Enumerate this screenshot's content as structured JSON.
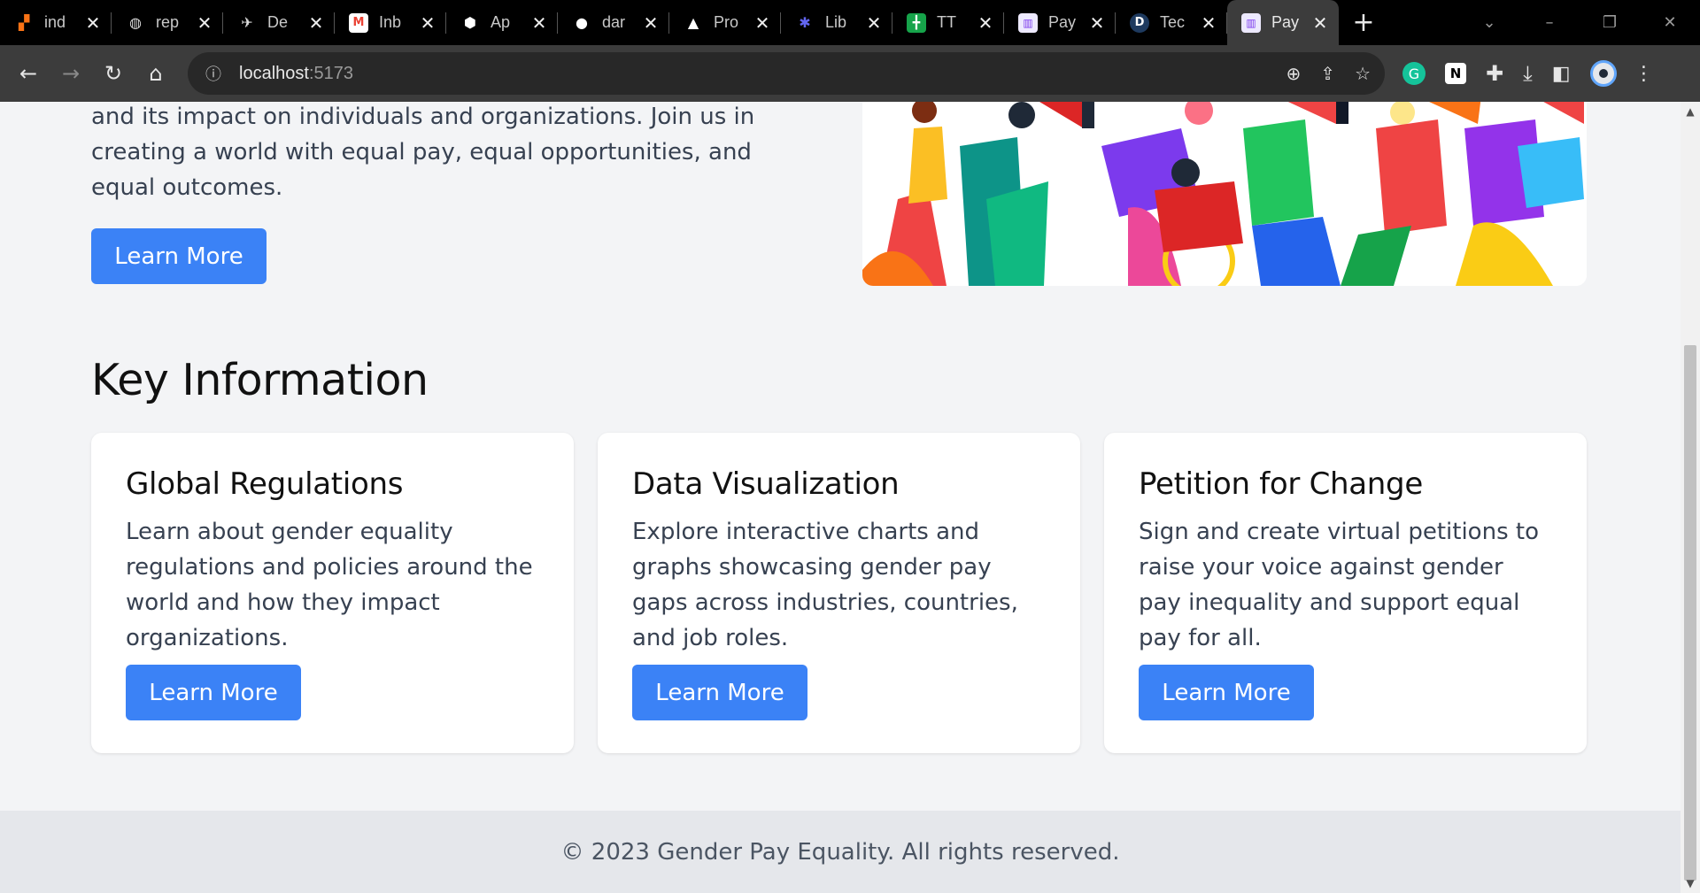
{
  "browser": {
    "tabs": [
      {
        "title": "ind",
        "icon": "orange-blocks-icon",
        "color": "#f97316"
      },
      {
        "title": "rep",
        "icon": "globe-icon",
        "color": "#d1d5db"
      },
      {
        "title": "De",
        "icon": "bird-icon",
        "color": "#d1d5db"
      },
      {
        "title": "Inb",
        "icon": "gmail-icon",
        "color": "#ea4335"
      },
      {
        "title": "Ap",
        "icon": "angular-icon",
        "color": "#ffffff"
      },
      {
        "title": "dar",
        "icon": "github-icon",
        "color": "#ffffff"
      },
      {
        "title": "Pro",
        "icon": "vercel-icon",
        "color": "#ffffff"
      },
      {
        "title": "Lib",
        "icon": "snowflake-icon",
        "color": "#6366f1"
      },
      {
        "title": "TT",
        "icon": "sheets-icon",
        "color": "#16a34a"
      },
      {
        "title": "Pay",
        "icon": "chart-favicon-icon",
        "color": "#a78bfa"
      },
      {
        "title": "Tec",
        "icon": "d-letter-icon",
        "color": "#1e3a5f"
      },
      {
        "title": "Pay",
        "icon": "chart-favicon-icon",
        "color": "#a78bfa",
        "active": true
      }
    ],
    "url_host": "localhost",
    "url_port": ":5173"
  },
  "hero": {
    "text": "and its impact on individuals and organizations. Join us in creating a world with equal pay, equal opportunities, and equal outcomes.",
    "button_label": "Learn More"
  },
  "key_info": {
    "title": "Key Information",
    "cards": [
      {
        "title": "Global Regulations",
        "body": "Learn about gender equality regulations and policies around the world and how they impact organizations.",
        "button": "Learn More"
      },
      {
        "title": "Data Visualization",
        "body": "Explore interactive charts and graphs showcasing gender pay gaps across industries, countries, and job roles.",
        "button": "Learn More"
      },
      {
        "title": "Petition for Change",
        "body": "Sign and create virtual petitions to raise your voice against gender pay inequality and support equal pay for all.",
        "button": "Learn More"
      }
    ]
  },
  "footer": {
    "text": "© 2023 Gender Pay Equality. All rights reserved."
  },
  "colors": {
    "accent": "#3b82f6",
    "page_bg": "#f3f4f6",
    "footer_bg": "#e5e7eb"
  }
}
